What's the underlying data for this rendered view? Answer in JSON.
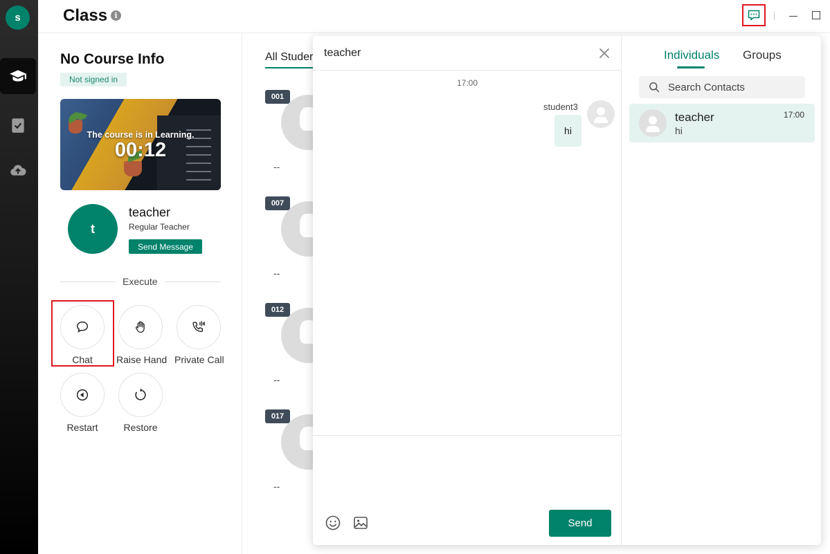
{
  "rail": {
    "avatar_letter": "s",
    "items": [
      {
        "name": "class-nav",
        "icon": "graduation-cap-icon",
        "active": true
      },
      {
        "name": "tasks-nav",
        "icon": "clipboard-check-icon",
        "active": false
      },
      {
        "name": "upload-nav",
        "icon": "cloud-upload-icon",
        "active": false
      }
    ]
  },
  "header": {
    "title": "Class",
    "info_icon": "i"
  },
  "course": {
    "title": "No Course Info",
    "status": "Not signed in",
    "video": {
      "status_text": "The course is in Learning.",
      "timer": "00:12"
    },
    "teacher": {
      "avatar_letter": "t",
      "name": "teacher",
      "role": "Regular Teacher",
      "send_message_label": "Send Message"
    },
    "execute_label": "Execute",
    "actions": [
      {
        "label": "Chat",
        "icon": "chat-bubble-icon"
      },
      {
        "label": "Raise Hand",
        "icon": "hand-icon"
      },
      {
        "label": "Private Call",
        "icon": "phone-call-icon"
      },
      {
        "label": "Restart",
        "icon": "rewind-icon"
      },
      {
        "label": "Restore",
        "icon": "refresh-icon"
      }
    ]
  },
  "students": {
    "tab_label": "All Studer",
    "items": [
      {
        "number": "001",
        "name": "--"
      },
      {
        "number": "007",
        "name": "--"
      },
      {
        "number": "012",
        "name": "--"
      },
      {
        "number": "017",
        "name": "--"
      }
    ]
  },
  "chat": {
    "conversation_title": "teacher",
    "messages": [
      {
        "time": "17:00",
        "sender": "student3",
        "text": "hi"
      }
    ],
    "send_label": "Send",
    "tabs": {
      "individuals": "Individuals",
      "groups": "Groups"
    },
    "search_placeholder": "Search Contacts",
    "contacts": [
      {
        "name": "teacher",
        "last_message": "hi",
        "time": "17:00"
      }
    ]
  },
  "colors": {
    "accent": "#00826b",
    "accent_light": "#e4f3ef",
    "highlight_box": "#e0161e"
  }
}
